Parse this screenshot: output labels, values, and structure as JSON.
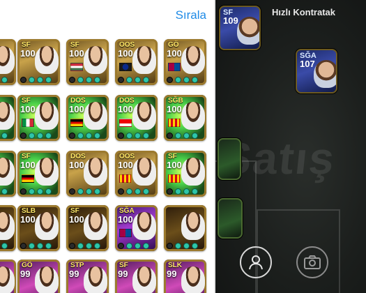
{
  "header": {
    "sort_label": "Sırala"
  },
  "background": {
    "title": "Hızlı Kontratak",
    "watermark": "Satış",
    "cards": [
      {
        "position": "SF",
        "rating": "109",
        "style": "blue"
      },
      {
        "position": "SĞA",
        "rating": "107",
        "style": "blue"
      }
    ],
    "buttons": [
      {
        "icon": "person-icon"
      },
      {
        "icon": "camera-icon"
      }
    ]
  },
  "cards": [
    {
      "position": "",
      "rating": "",
      "style": "gold"
    },
    {
      "position": "SF",
      "rating": "100",
      "style": "gold"
    },
    {
      "position": "SF",
      "rating": "100",
      "style": "gold"
    },
    {
      "position": "OOS",
      "rating": "100",
      "style": "gold"
    },
    {
      "position": "GÖ",
      "rating": "100",
      "style": "gold"
    },
    {
      "position": "",
      "rating": "",
      "style": "green"
    },
    {
      "position": "SF",
      "rating": "100",
      "style": "green"
    },
    {
      "position": "DOS",
      "rating": "100",
      "style": "green"
    },
    {
      "position": "DOS",
      "rating": "100",
      "style": "green"
    },
    {
      "position": "SĞB",
      "rating": "100",
      "style": "green"
    },
    {
      "position": "",
      "rating": "",
      "style": "green"
    },
    {
      "position": "SF",
      "rating": "100",
      "style": "green"
    },
    {
      "position": "DOS",
      "rating": "100",
      "style": "gold"
    },
    {
      "position": "OOS",
      "rating": "100",
      "style": "gold"
    },
    {
      "position": "SF",
      "rating": "100",
      "style": "green"
    },
    {
      "position": "",
      "rating": "",
      "style": "dark"
    },
    {
      "position": "SLB",
      "rating": "100",
      "style": "dark"
    },
    {
      "position": "SF",
      "rating": "100",
      "style": "dark"
    },
    {
      "position": "SĞA",
      "rating": "100",
      "style": "purple"
    },
    {
      "position": "",
      "rating": "",
      "style": "dark"
    },
    {
      "position": "",
      "rating": "",
      "style": "pink"
    },
    {
      "position": "GÖ",
      "rating": "99",
      "style": "pink"
    },
    {
      "position": "STP",
      "rating": "99",
      "style": "pink"
    },
    {
      "position": "SF",
      "rating": "99",
      "style": "pink"
    },
    {
      "position": "SLK",
      "rating": "99",
      "style": "pink"
    }
  ],
  "flags": {
    "row0": [
      "",
      "",
      "hungary",
      "inter",
      "barcelona"
    ],
    "row1": [
      "",
      "italy",
      "germany",
      "arsenal",
      "valencia"
    ],
    "row2": [
      "",
      "germany",
      "",
      "valencia",
      "valencia"
    ],
    "row3": [
      "",
      "",
      "",
      "barcelona",
      ""
    ],
    "row4": [
      "",
      "",
      "",
      "",
      ""
    ]
  }
}
